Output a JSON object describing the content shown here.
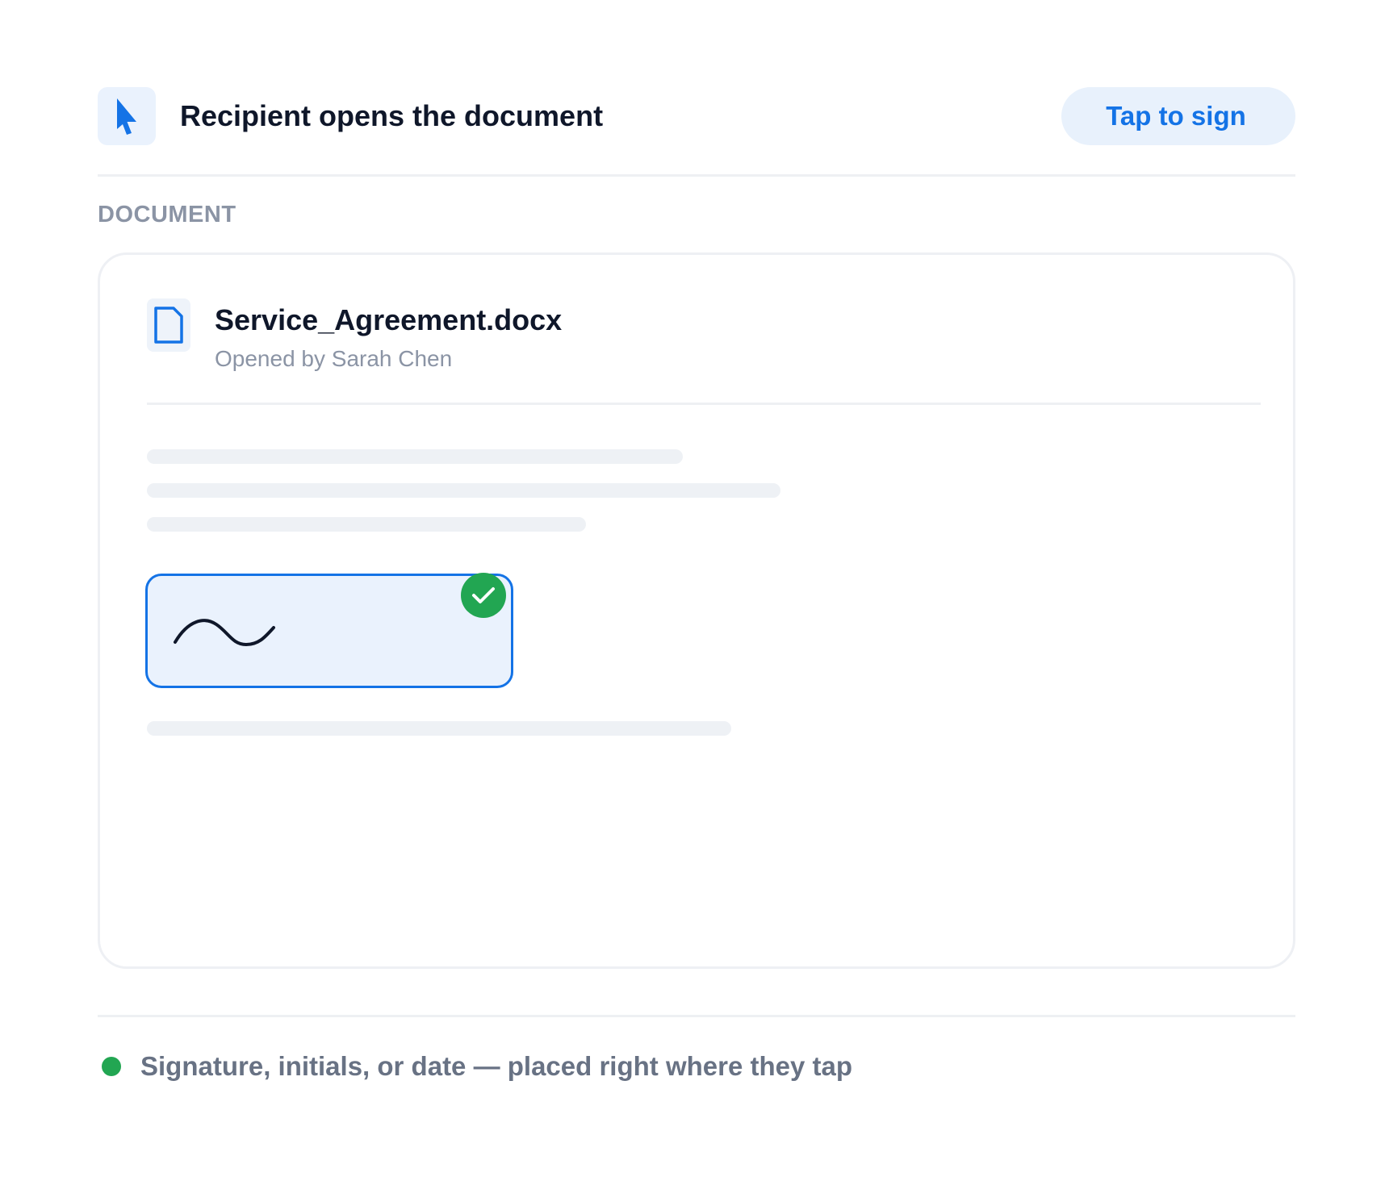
{
  "header": {
    "icon": "cursor-arrow-icon",
    "title": "Recipient opens the document",
    "action_label": "Tap to sign"
  },
  "section": {
    "label": "DOCUMENT"
  },
  "document": {
    "icon": "document-file-icon",
    "file_name": "Service_Agreement.docx",
    "subtitle": "Opened by Sarah Chen",
    "signature_field": {
      "status_icon": "check-icon",
      "signed": true
    }
  },
  "footer": {
    "note": "Signature, initials, or date — placed right where they tap"
  },
  "colors": {
    "accent": "#1473e6",
    "accent_bg": "#eaf2fd",
    "success": "#22a652",
    "heading": "#0f172a",
    "muted": "#8b94a5",
    "footer_text": "#687284"
  }
}
